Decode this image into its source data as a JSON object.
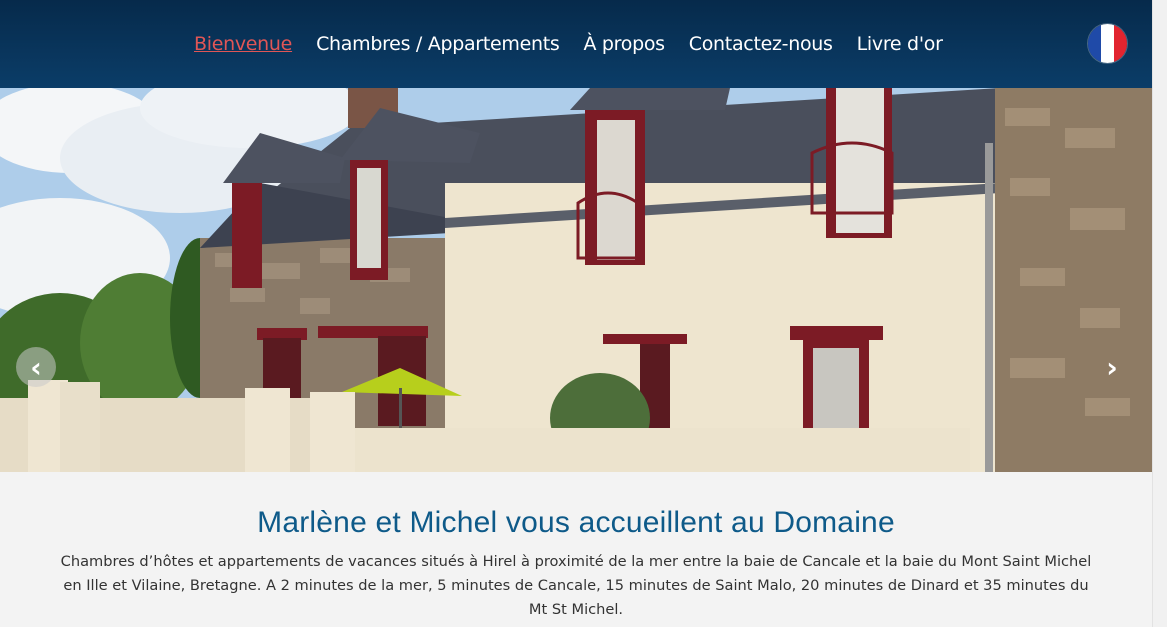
{
  "nav": {
    "items": [
      {
        "label": "Bienvenue",
        "active": true
      },
      {
        "label": "Chambres / Appartements",
        "active": false
      },
      {
        "label": "À propos",
        "active": false
      },
      {
        "label": "Contactez-nous",
        "active": false
      },
      {
        "label": "Livre d'or",
        "active": false
      }
    ],
    "language_icon": "french-flag-icon"
  },
  "carousel": {
    "prev_icon": "chevron-left-icon",
    "next_icon": "chevron-right-icon",
    "prev_label": "‹",
    "next_label": "›"
  },
  "intro": {
    "title": "Marlène et Michel vous accueillent au Domaine",
    "text": "Chambres d’hôtes et appartements de vacances situés à Hirel à proximité de la mer entre la baie de Cancale et la baie du Mont Saint Michel en Ille et Vilaine, Bretagne. A 2 minutes de la mer, 5 minutes de Cancale, 15 minutes de Saint Malo, 20 minutes de Dinard et 35 minutes du Mt St Michel."
  },
  "colors": {
    "navbar": "#0b3d68",
    "active_link": "#e05656",
    "title": "#0e5a89",
    "flag_blue": "#1f4aa8",
    "flag_white": "#ffffff",
    "flag_red": "#e2242f"
  }
}
